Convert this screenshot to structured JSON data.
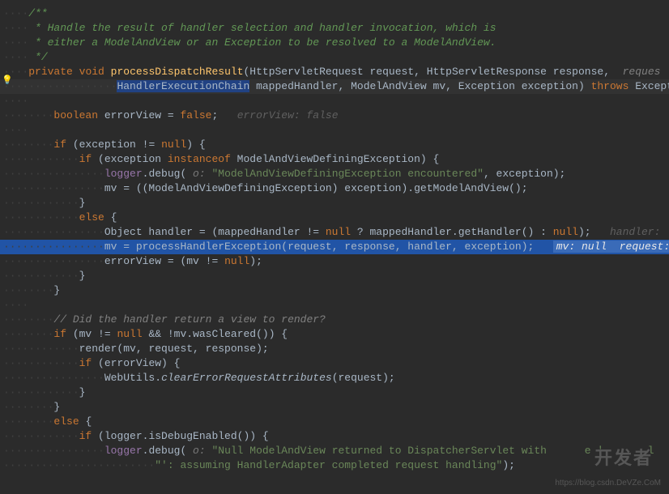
{
  "code": {
    "comment_start": "/**",
    "comment_l1": " * Handle the result of handler selection and handler invocation, which is",
    "comment_l2": " * either a ModelAndView or an Exception to be resolved to a ModelAndView.",
    "comment_end": " */",
    "kw_private": "private",
    "kw_void": "void",
    "method_name": "processDispatchResult",
    "sig_open": "(HttpServletRequest request",
    "sig_p2": " HttpServletResponse response",
    "sig_tail": "reques",
    "handler_chain": "HandlerExecutionChain",
    "sig_l2": " mappedHandler",
    "sig_l2b": " ModelAndView mv",
    "sig_l2c": " Exception exception) ",
    "kw_throws": "throws",
    "sig_exc": " Exception",
    "kw_boolean": "boolean",
    "var_errorView": " errorView = ",
    "kw_false": "false",
    "hint_errorView": "errorView: false",
    "kw_if": "if",
    "cond_exc_null": " (exception != ",
    "kw_null": "null",
    "brace_open": ") {",
    "kw_instanceof": "instanceof",
    "cond_inst": " (exception ",
    "inst_type": " ModelAndViewDefiningException) {",
    "logger": "logger",
    "debug_call": ".debug(",
    "param_o": " o: ",
    "str_mvde": "\"ModelAndViewDefiningException encountered\"",
    "debug_tail": ", exception);",
    "mv_assign": "mv = ((ModelAndViewDefiningException) exception).getModelAndView();",
    "brace_close": "}",
    "kw_else": "else",
    "else_open": " {",
    "obj_handler": "Object handler = (mappedHandler != ",
    "tern_q": " ? mappedHandler.getHandler() : ",
    "tern_end": ");",
    "hint_handler": "handler:",
    "mv_proc": "mv = processHandlerException(request",
    "proc_args": ", response, handler, exception);",
    "exec_hint": "mv: null  request:",
    "errview_assign": "errorView = (mv != ",
    "errview_end": ");",
    "comment_render": "// Did the handler return a view to render?",
    "cond_mv": " (mv != ",
    "cond_mv2": " && !mv.wasCleared()) {",
    "render_call": "render(mv",
    "render_args": ", request, response);",
    "cond_errview": " (errorView) {",
    "webutils": "WebUtils",
    "clear_method": "clearErrorRequestAttributes",
    "clear_args": "(request);",
    "cond_logger": " (logger.isDebugEnabled()) {",
    "str_null_mv": "\"Null ModelAndView returned to DispatcherServlet with",
    "str_null_mv_tail": "e '",
    "str_tail": "l",
    "str_l2": "\"': assuming HandlerAdapter completed request handling\"",
    "debug_end": ");"
  },
  "watermark": {
    "big": "开发者",
    "small": "https://blog.csdn.DeVZe.CoM"
  }
}
